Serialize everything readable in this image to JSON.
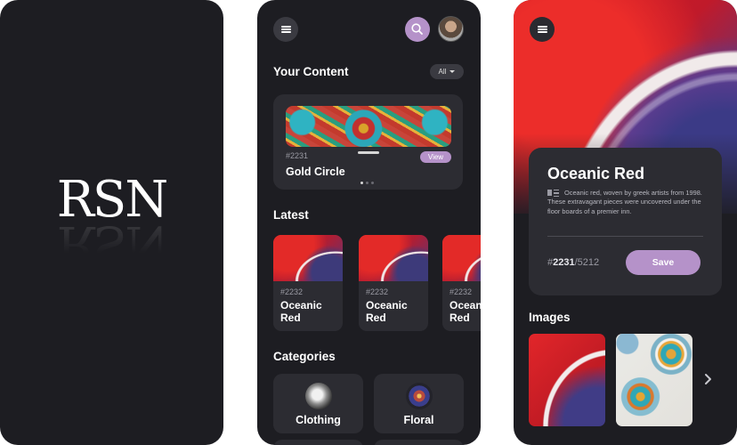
{
  "splash": {
    "logo": "RSN"
  },
  "home": {
    "your_content_title": "Your Content",
    "filter_label": "All",
    "featured": {
      "id": "#2231",
      "name": "Gold Circle",
      "view_label": "View"
    },
    "latest_title": "Latest",
    "latest_items": [
      {
        "id": "#2232",
        "name": "Oceanic Red"
      },
      {
        "id": "#2232",
        "name": "Oceanic Red"
      },
      {
        "id": "#2232",
        "name": "Oceanic Red"
      }
    ],
    "categories_title": "Categories",
    "categories": [
      {
        "label": "Clothing"
      },
      {
        "label": "Floral"
      }
    ]
  },
  "detail": {
    "title": "Oceanic Red",
    "description": "Oceanic red, woven by greek artists from 1998. These extravagant pieces were uncovered under the floor boards of a premier inn.",
    "count_prefix": "#",
    "count_current": "2231",
    "count_total": "/5212",
    "save_label": "Save",
    "images_title": "Images"
  },
  "colors": {
    "background": "#1d1d22",
    "card": "#2c2c32",
    "accent": "#b592c9"
  },
  "icons": [
    "menu-icon",
    "search-icon",
    "chevron-down-icon",
    "description-icon",
    "chevron-right-icon"
  ]
}
